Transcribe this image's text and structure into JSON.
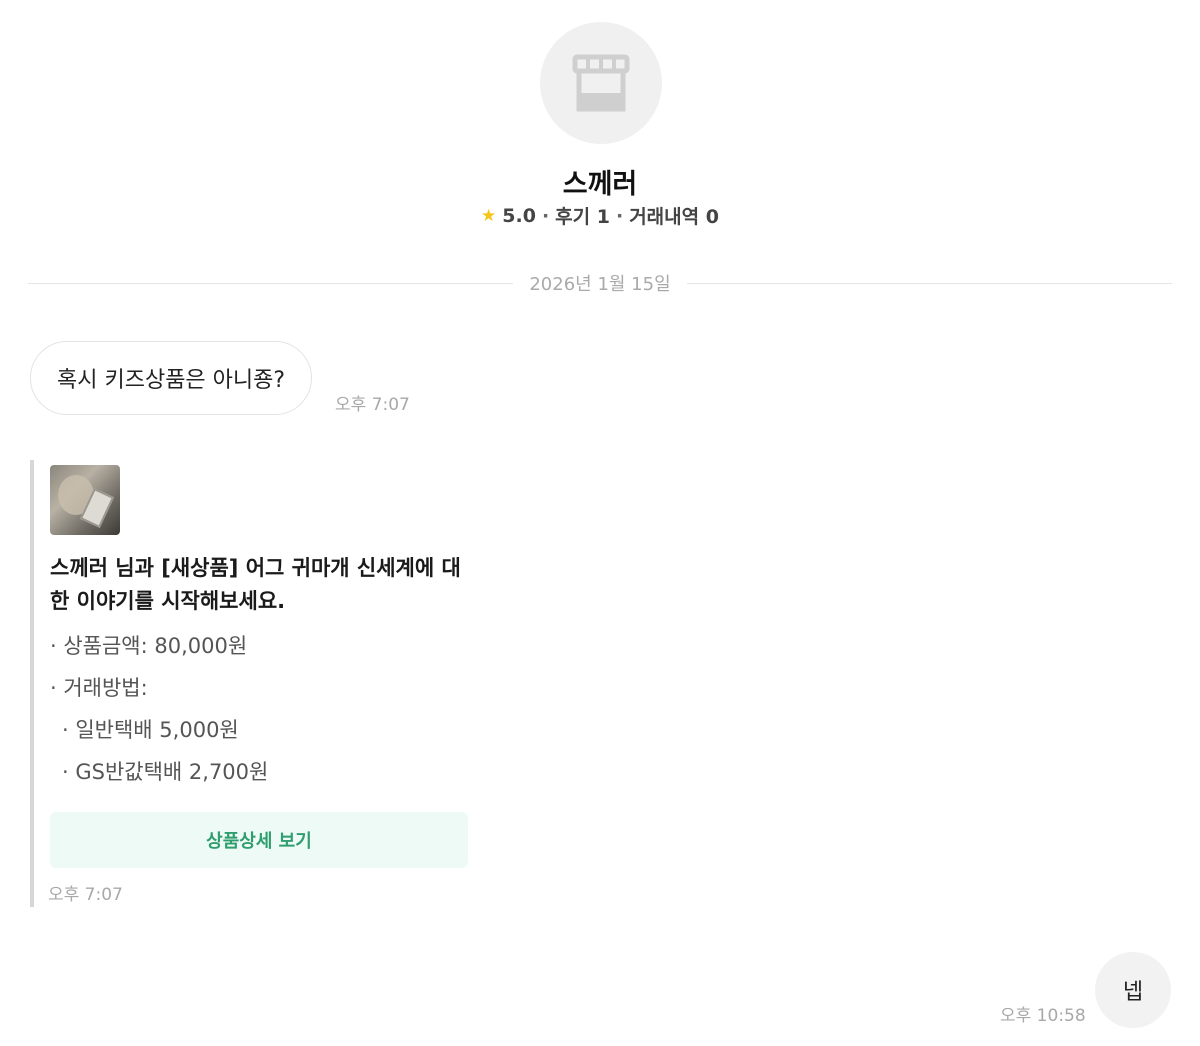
{
  "profile": {
    "icon": "store-icon",
    "name": "스께러",
    "rating": "5.0",
    "reviews": "후기 1",
    "trades": "거래내역 0"
  },
  "date_divider": "2026년 1월 15일",
  "messages": [
    {
      "side": "incoming",
      "text": "혹시 키즈상품은 아니죵?",
      "time": "오후 7:07"
    },
    {
      "side": "outgoing",
      "text": "넵",
      "time": "오후 10:58"
    }
  ],
  "product_card": {
    "title": "스께러 님과 [새상품] 어그 귀마개 신세계에 대한 이야기를 시작해보세요.",
    "price_line": "· 상품금액: 80,000원",
    "method_label": "· 거래방법:",
    "methods": [
      "· 일반택배 5,000원",
      "· GS반값택배 2,700원"
    ],
    "button_label": "상품상세 보기",
    "time": "오후 7:07"
  },
  "colors": {
    "accent_green": "#2f9e6e",
    "button_bg": "#eefaf5",
    "star": "#f5c518"
  }
}
